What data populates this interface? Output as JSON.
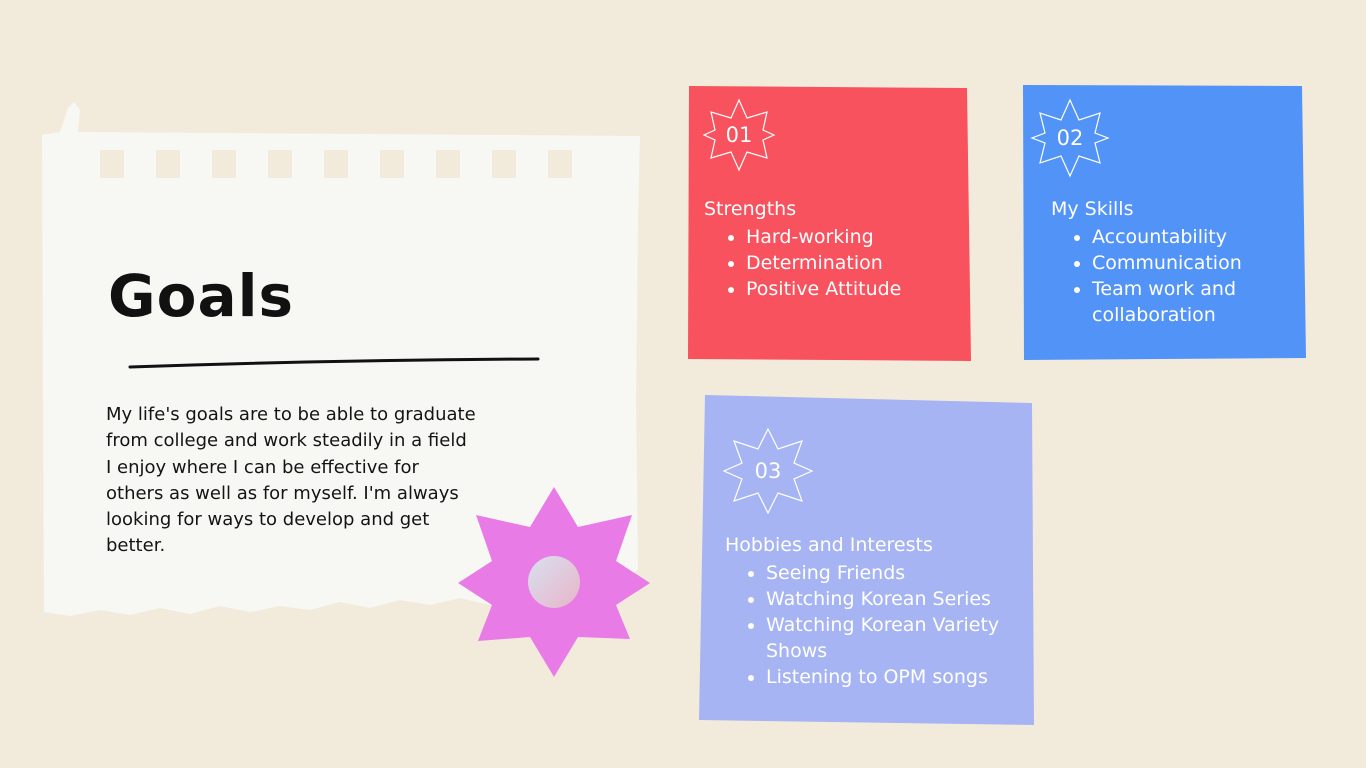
{
  "goals": {
    "title": "Goals",
    "description": "My life's goals are to be able to graduate from college and work steadily in a field I enjoy where I can be effective for others as well as for myself. I'm always looking for ways to develop and get better."
  },
  "cards": [
    {
      "number": "01",
      "heading": "Strengths",
      "items": [
        "Hard-working",
        "Determination",
        "Positive Attitude"
      ],
      "color": "#f7525e"
    },
    {
      "number": "02",
      "heading": "My Skills",
      "items": [
        "Accountability",
        "Communication",
        "Team work and collaboration"
      ],
      "color": "#5293f8"
    },
    {
      "number": "03",
      "heading": "Hobbies and Interests",
      "items": [
        "Seeing Friends",
        " Watching Korean Series",
        " Watching Korean Variety Shows",
        "Listening to OPM songs"
      ],
      "color": "#a6b4f4"
    }
  ],
  "colors": {
    "background": "#f2ebdc",
    "paper": "#f7f8f4",
    "star_sticker": "#e87be6"
  }
}
